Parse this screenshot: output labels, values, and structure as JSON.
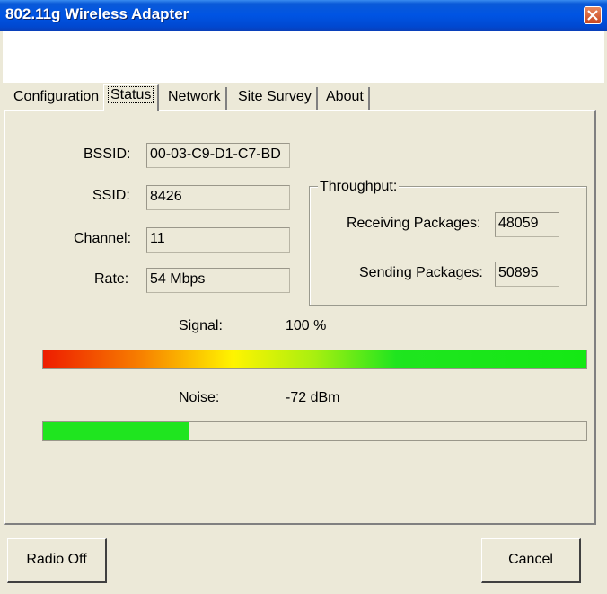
{
  "window": {
    "title": "802.11g Wireless Adapter"
  },
  "tabs": [
    "Configuration",
    "Status",
    "Network",
    "Site Survey",
    "About"
  ],
  "active_tab": "Status",
  "status": {
    "bssid_label": "BSSID:",
    "bssid": "00-03-C9-D1-C7-BD",
    "ssid_label": "SSID:",
    "ssid": "8426",
    "channel_label": "Channel:",
    "channel": "11",
    "rate_label": "Rate:",
    "rate": "54 Mbps"
  },
  "throughput": {
    "legend": "Throughput:",
    "receiving_label": "Receiving Packages:",
    "receiving": "48059",
    "sending_label": "Sending Packages:",
    "sending": "50895"
  },
  "signal": {
    "label": "Signal:",
    "value": "100 %",
    "level_percent": 100
  },
  "noise": {
    "label": "Noise:",
    "value": "-72 dBm",
    "level_percent": 27,
    "color": "#1fe51f"
  },
  "buttons": {
    "radio_off": "Radio Off",
    "cancel": "Cancel"
  }
}
